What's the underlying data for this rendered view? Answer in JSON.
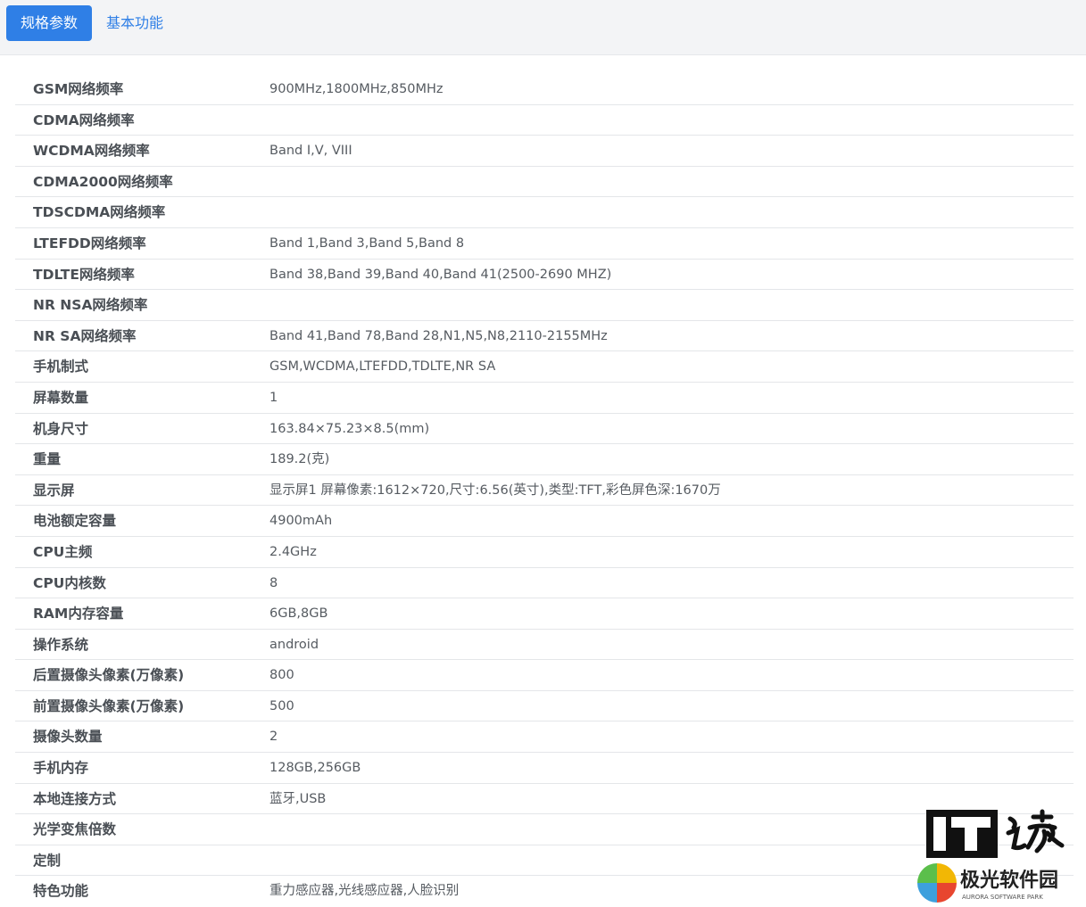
{
  "tabs": [
    {
      "label": "规格参数",
      "active": true
    },
    {
      "label": "基本功能",
      "active": false
    }
  ],
  "specs": [
    {
      "label": "GSM网络频率",
      "value": "900MHz,1800MHz,850MHz"
    },
    {
      "label": "CDMA网络频率",
      "value": ""
    },
    {
      "label": "WCDMA网络频率",
      "value": "Band Ⅰ,V, VIII"
    },
    {
      "label": "CDMA2000网络频率",
      "value": ""
    },
    {
      "label": "TDSCDMA网络频率",
      "value": ""
    },
    {
      "label": "LTEFDD网络频率",
      "value": "Band 1,Band 3,Band 5,Band 8"
    },
    {
      "label": "TDLTE网络频率",
      "value": "Band 38,Band 39,Band 40,Band 41(2500-2690 MHZ)"
    },
    {
      "label": "NR NSA网络频率",
      "value": ""
    },
    {
      "label": "NR SA网络频率",
      "value": "Band 41,Band 78,Band 28,N1,N5,N8,2110-2155MHz"
    },
    {
      "label": "手机制式",
      "value": "GSM,WCDMA,LTEFDD,TDLTE,NR SA"
    },
    {
      "label": "屏幕数量",
      "value": "1"
    },
    {
      "label": "机身尺寸",
      "value": "163.84×75.23×8.5(mm)"
    },
    {
      "label": "重量",
      "value": "189.2(克)"
    },
    {
      "label": "显示屏",
      "value": "显示屏1 屏幕像素:1612×720,尺寸:6.56(英寸),类型:TFT,彩色屏色深:1670万"
    },
    {
      "label": "电池额定容量",
      "value": "4900mAh"
    },
    {
      "label": "CPU主频",
      "value": "2.4GHz"
    },
    {
      "label": "CPU内核数",
      "value": "8"
    },
    {
      "label": "RAM内存容量",
      "value": "6GB,8GB"
    },
    {
      "label": "操作系统",
      "value": "android"
    },
    {
      "label": "后置摄像头像素(万像素)",
      "value": "800"
    },
    {
      "label": "前置摄像头像素(万像素)",
      "value": "500"
    },
    {
      "label": "摄像头数量",
      "value": "2"
    },
    {
      "label": "手机内存",
      "value": "128GB,256GB"
    },
    {
      "label": "本地连接方式",
      "value": "蓝牙,USB"
    },
    {
      "label": "光学变焦倍数",
      "value": ""
    },
    {
      "label": "定制",
      "value": ""
    },
    {
      "label": "特色功能",
      "value": "重力感应器,光线感应器,人脸识别"
    }
  ],
  "watermark": {
    "logo_text": "IT之家",
    "brand_cn": "极光软件园",
    "brand_en": "AURORA SOFTWARE PARK"
  },
  "colors": {
    "accent": "#2f7fe6",
    "tabbar_bg": "#f3f4f6",
    "label": "#4a4f55",
    "value": "#565b61",
    "divider": "#e4e6e9"
  }
}
